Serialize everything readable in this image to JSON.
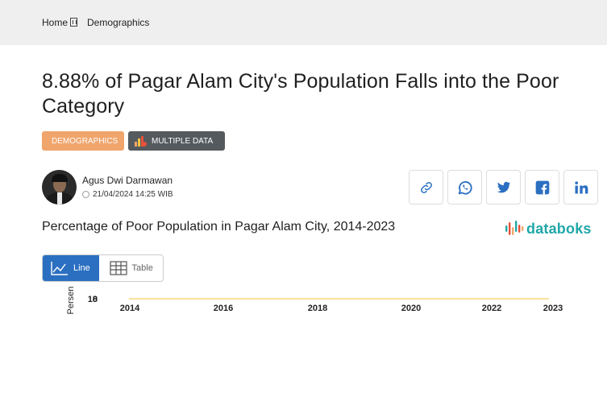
{
  "breadcrumb": {
    "home": "Home",
    "current": "Demographics"
  },
  "article": {
    "title": "8.88% of Pagar Alam City's Population Falls into the Poor Category",
    "tags": {
      "category": "DEMOGRAPHICS",
      "multiple": "MULTIPLE DATA"
    },
    "author": {
      "name": "Agus Dwi Darmawan",
      "date": "21/04/2024 14:25 WIB"
    }
  },
  "share": [
    "link-icon",
    "whatsapp-icon",
    "twitter-icon",
    "facebook-icon",
    "linkedin-icon"
  ],
  "brand": {
    "logo_text": "databoks",
    "color": "#21a7a8",
    "accent": "#2b6fc1"
  },
  "view_toggle": {
    "line_label": "Line",
    "table_label": "Table",
    "selected": "Line"
  },
  "chart_data": {
    "type": "line",
    "title": "Percentage of Poor Population in Pagar Alam City, 2014-2023",
    "ylabel": "Persen",
    "ytick_labels": [
      "10",
      "8"
    ],
    "x_tick_labels": [
      "2014",
      "2016",
      "2018",
      "2020",
      "2022",
      "2023"
    ],
    "x": [
      2014,
      2023
    ],
    "series": [
      {
        "values": [
          8.88,
          8.88
        ],
        "color": "#f5d77a"
      }
    ]
  }
}
